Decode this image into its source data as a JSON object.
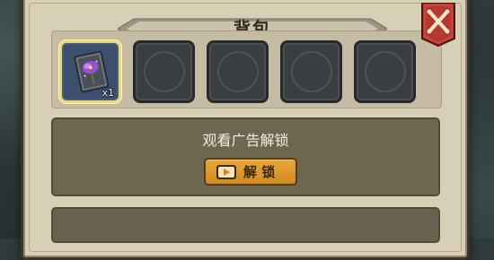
{
  "window": {
    "title": "背包"
  },
  "inventory": {
    "slots": [
      {
        "item": "purple-flower-card",
        "quantity": "x1",
        "selected": true
      },
      {
        "item": null
      },
      {
        "item": null
      },
      {
        "item": null
      },
      {
        "item": null
      }
    ]
  },
  "unlock": {
    "prompt": "观看广告解锁",
    "button_label": "解 锁",
    "button_icon": "play-video-icon"
  },
  "close": {
    "icon": "close-x-icon"
  },
  "colors": {
    "panel": "#d8cfb7",
    "button": "#e0992c",
    "close_button": "#b5372f",
    "selected_border": "#e8d77c"
  }
}
